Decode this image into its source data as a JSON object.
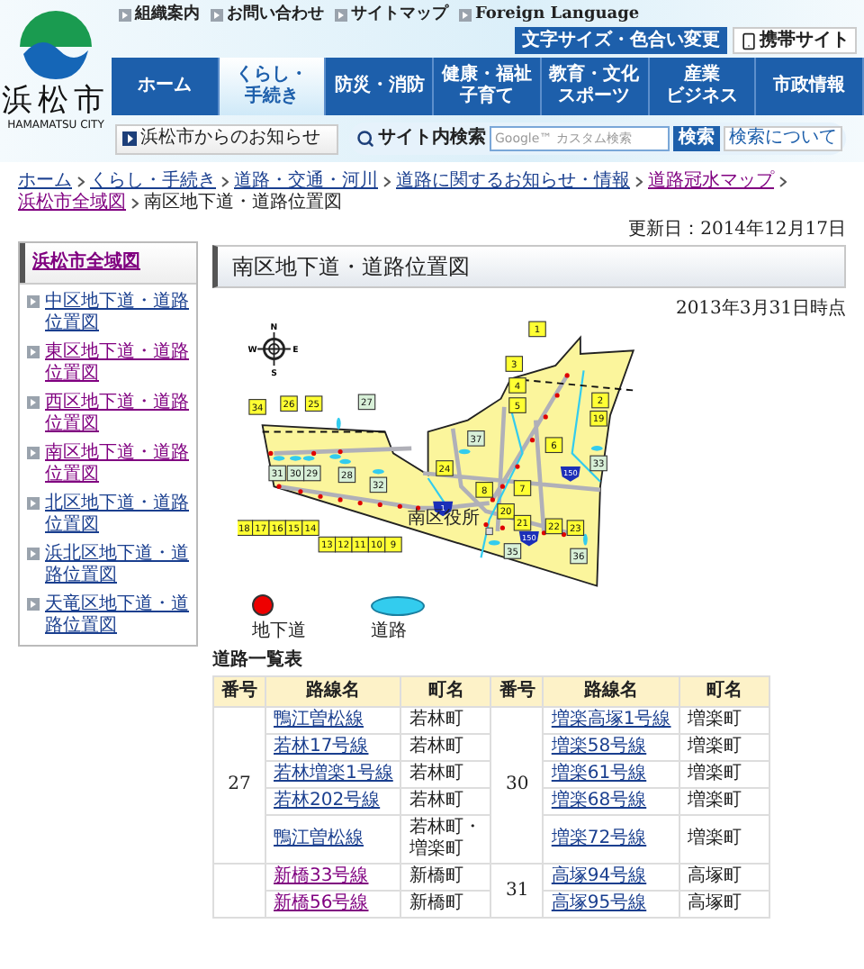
{
  "header": {
    "logo": {
      "name": "浜松市",
      "romaji": "HAMAMATSU CITY"
    },
    "top_links": [
      "組織案内",
      "お問い合わせ",
      "サイトマップ",
      "Foreign Language"
    ],
    "utility_buttons": [
      {
        "kind": "text",
        "label": "文字サイズ・色合い変更"
      },
      {
        "kind": "mobile",
        "label": "携帯サイト"
      }
    ],
    "nav": [
      {
        "lines": [
          "ホーム"
        ],
        "selected": false
      },
      {
        "lines": [
          "くらし・",
          "手続き"
        ],
        "selected": true
      },
      {
        "lines": [
          "防災・消防"
        ],
        "selected": false
      },
      {
        "lines": [
          "健康・福祉",
          "子育て"
        ],
        "selected": false
      },
      {
        "lines": [
          "教育・文化",
          "スポーツ"
        ],
        "selected": false
      },
      {
        "lines": [
          "産業",
          "ビジネス"
        ],
        "selected": false
      },
      {
        "lines": [
          "市政情報"
        ],
        "selected": false
      }
    ],
    "notice": "浜松市からのお知らせ",
    "search": {
      "label": "サイト内検索",
      "placeholder": "Google™ カスタム検索",
      "button": "検索",
      "help": "検索について"
    }
  },
  "breadcrumb": {
    "links": [
      {
        "label": "ホーム",
        "visited": false
      },
      {
        "label": "くらし・手続き",
        "visited": false
      },
      {
        "label": "道路・交通・河川",
        "visited": false
      },
      {
        "label": "道路に関するお知らせ・情報",
        "visited": false
      },
      {
        "label": "道路冠水マップ",
        "visited": true
      },
      {
        "label": "浜松市全域図",
        "visited": true
      }
    ],
    "current": "南区地下道・道路位置図"
  },
  "updated": "更新日：2014年12月17日",
  "sidebar": {
    "title": {
      "label": "浜松市全域図",
      "visited": true
    },
    "items": [
      {
        "label": "中区地下道・道路位置図",
        "visited": false
      },
      {
        "label": "東区地下道・道路位置図",
        "visited": true
      },
      {
        "label": "西区地下道・道路位置図",
        "visited": true
      },
      {
        "label": "南区地下道・道路位置図",
        "visited": true
      },
      {
        "label": "北区地下道・道路位置図",
        "visited": false
      },
      {
        "label": "浜北区地下道・道路位置図",
        "visited": false
      },
      {
        "label": "天竜区地下道・道路位置図",
        "visited": false
      }
    ]
  },
  "page_title": "南区地下道・道路位置図",
  "as_of": "2013年3月31日時点",
  "map": {
    "compass": [
      "N",
      "E",
      "S",
      "W"
    ],
    "labels": [
      {
        "text": "1",
        "kind": "underpass"
      },
      {
        "text": "3",
        "kind": "underpass"
      },
      {
        "text": "4",
        "kind": "underpass"
      },
      {
        "text": "34",
        "kind": "underpass"
      },
      {
        "text": "26",
        "kind": "underpass"
      },
      {
        "text": "25",
        "kind": "underpass"
      },
      {
        "text": "27",
        "kind": "road"
      },
      {
        "text": "5",
        "kind": "underpass"
      },
      {
        "text": "2",
        "kind": "underpass"
      },
      {
        "text": "19",
        "kind": "underpass"
      },
      {
        "text": "37",
        "kind": "road"
      },
      {
        "text": "6",
        "kind": "underpass"
      },
      {
        "text": "31",
        "kind": "road"
      },
      {
        "text": "30",
        "kind": "road"
      },
      {
        "text": "29",
        "kind": "road"
      },
      {
        "text": "28",
        "kind": "road"
      },
      {
        "text": "24",
        "kind": "underpass"
      },
      {
        "text": "33",
        "kind": "road"
      },
      {
        "text": "32",
        "kind": "road"
      },
      {
        "text": "8",
        "kind": "underpass"
      },
      {
        "text": "7",
        "kind": "underpass"
      },
      {
        "text": "20",
        "kind": "underpass"
      },
      {
        "text": "18",
        "kind": "underpass"
      },
      {
        "text": "17",
        "kind": "underpass"
      },
      {
        "text": "16",
        "kind": "underpass"
      },
      {
        "text": "15",
        "kind": "underpass"
      },
      {
        "text": "14",
        "kind": "underpass"
      },
      {
        "text": "21",
        "kind": "underpass"
      },
      {
        "text": "22",
        "kind": "underpass"
      },
      {
        "text": "23",
        "kind": "underpass"
      },
      {
        "text": "13",
        "kind": "underpass"
      },
      {
        "text": "12",
        "kind": "underpass"
      },
      {
        "text": "11",
        "kind": "underpass"
      },
      {
        "text": "10",
        "kind": "underpass"
      },
      {
        "text": "9",
        "kind": "underpass"
      },
      {
        "text": "35",
        "kind": "road"
      },
      {
        "text": "36",
        "kind": "road"
      }
    ],
    "route_markers": [
      "150",
      "1",
      "150"
    ],
    "office": "南区役所"
  },
  "legend": [
    {
      "kind": "underpass",
      "label": "地下道"
    },
    {
      "kind": "road",
      "label": "道路"
    }
  ],
  "table": {
    "caption": "道路一覧表",
    "columns": [
      "番号",
      "路線名",
      "町名",
      "番号",
      "路線名",
      "町名"
    ],
    "groups": [
      {
        "left": {
          "number": "27",
          "roads": [
            {
              "name": "鴨江曽松線",
              "town": "若林町",
              "visited": false
            },
            {
              "name": "若林17号線",
              "town": "若林町",
              "visited": false
            },
            {
              "name": "若林増楽1号線",
              "town": "若林町",
              "visited": false
            },
            {
              "name": "若林202号線",
              "town": "若林町",
              "visited": false
            },
            {
              "name": "鴨江曽松線",
              "town": "若林町・増楽町",
              "visited": false
            }
          ]
        },
        "right": {
          "number": "30",
          "roads": [
            {
              "name": "増楽高塚1号線",
              "town": "増楽町",
              "visited": false
            },
            {
              "name": "増楽58号線",
              "town": "増楽町",
              "visited": false
            },
            {
              "name": "増楽61号線",
              "town": "増楽町",
              "visited": false
            },
            {
              "name": "増楽68号線",
              "town": "増楽町",
              "visited": false
            },
            {
              "name": "増楽72号線",
              "town": "増楽町",
              "visited": false
            }
          ]
        }
      },
      {
        "left": {
          "roads": [
            {
              "name": "新橋33号線",
              "town": "新橋町",
              "visited": true
            },
            {
              "name": "新橋56号線",
              "town": "新橋町",
              "visited": true
            }
          ]
        },
        "right": {
          "number": "31",
          "roads": [
            {
              "name": "高塚94号線",
              "town": "高塚町",
              "visited": false
            },
            {
              "name": "高塚95号線",
              "town": "高塚町",
              "visited": false
            }
          ]
        }
      }
    ]
  }
}
